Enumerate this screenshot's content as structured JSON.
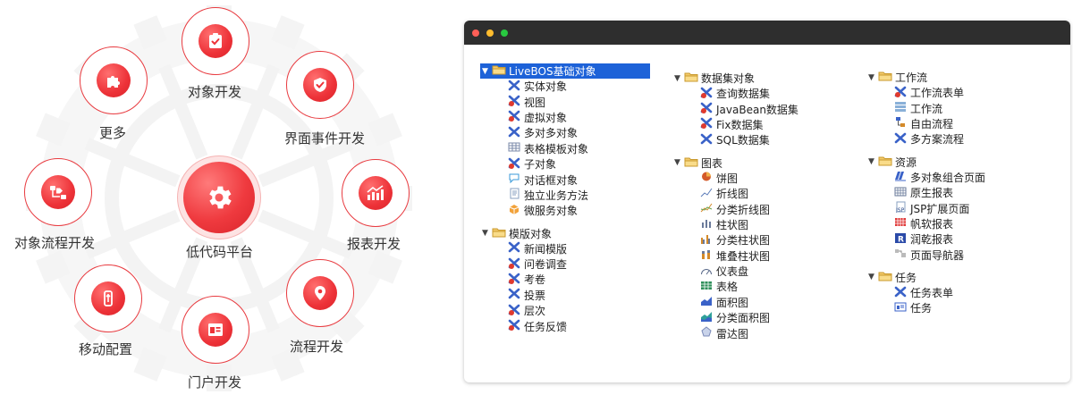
{
  "wheel": {
    "center_label": "低代码平台",
    "nodes": [
      {
        "label": "对象开发",
        "icon": "clipboard-check-icon"
      },
      {
        "label": "界面事件开发",
        "icon": "shield-check-icon"
      },
      {
        "label": "报表开发",
        "icon": "bar-chart-icon"
      },
      {
        "label": "流程开发",
        "icon": "map-pin-icon"
      },
      {
        "label": "门户开发",
        "icon": "portal-window-icon"
      },
      {
        "label": "移动配置",
        "icon": "usb-icon"
      },
      {
        "label": "对象流程开发",
        "icon": "flow-diagram-icon"
      },
      {
        "label": "更多",
        "icon": "puzzle-icon"
      }
    ]
  },
  "window": {
    "col1": [
      {
        "title": "LiveBOS基础对象",
        "selected": true,
        "items": [
          {
            "label": "实体对象",
            "icon": "x-node-icon"
          },
          {
            "label": "视图",
            "icon": "x-node-red-icon"
          },
          {
            "label": "虚拟对象",
            "icon": "x-node-red-icon"
          },
          {
            "label": "多对多对象",
            "icon": "x-node-icon"
          },
          {
            "label": "表格模板对象",
            "icon": "grid-icon"
          },
          {
            "label": "子对象",
            "icon": "x-node-red-icon"
          },
          {
            "label": "对话框对象",
            "icon": "speech-bubble-icon"
          },
          {
            "label": "独立业务方法",
            "icon": "document-icon"
          },
          {
            "label": "微服务对象",
            "icon": "cube-icon"
          }
        ]
      },
      {
        "title": "模版对象",
        "selected": false,
        "items": [
          {
            "label": "新闻模版",
            "icon": "x-node-icon"
          },
          {
            "label": "问卷调查",
            "icon": "x-node-red-icon"
          },
          {
            "label": "考卷",
            "icon": "x-node-red-icon"
          },
          {
            "label": "投票",
            "icon": "x-node-icon"
          },
          {
            "label": "层次",
            "icon": "x-node-red-icon"
          },
          {
            "label": "任务反馈",
            "icon": "x-node-red-icon"
          }
        ]
      }
    ],
    "col2": [
      {
        "title": "数据集对象",
        "selected": false,
        "items": [
          {
            "label": "查询数据集",
            "icon": "x-node-red-icon"
          },
          {
            "label": "JavaBean数据集",
            "icon": "x-node-red-icon"
          },
          {
            "label": "Fix数据集",
            "icon": "x-node-red-icon"
          },
          {
            "label": "SQL数据集",
            "icon": "x-node-icon"
          }
        ]
      },
      {
        "title": "图表",
        "selected": false,
        "items": [
          {
            "label": "饼图",
            "icon": "pie-chart-icon"
          },
          {
            "label": "折线图",
            "icon": "line-chart-icon"
          },
          {
            "label": "分类折线图",
            "icon": "multi-line-chart-icon"
          },
          {
            "label": "柱状图",
            "icon": "bar-chart-icon"
          },
          {
            "label": "分类柱状图",
            "icon": "grouped-bar-chart-icon"
          },
          {
            "label": "堆叠柱状图",
            "icon": "stacked-bar-chart-icon"
          },
          {
            "label": "仪表盘",
            "icon": "gauge-icon"
          },
          {
            "label": "表格",
            "icon": "table-icon"
          },
          {
            "label": "面积图",
            "icon": "area-chart-icon"
          },
          {
            "label": "分类面积图",
            "icon": "grouped-area-chart-icon"
          },
          {
            "label": "雷达图",
            "icon": "radar-chart-icon"
          }
        ]
      }
    ],
    "col3": [
      {
        "title": "工作流",
        "selected": false,
        "items": [
          {
            "label": "工作流表单",
            "icon": "x-node-red-icon"
          },
          {
            "label": "工作流",
            "icon": "workflow-icon"
          },
          {
            "label": "自由流程",
            "icon": "free-flow-icon"
          },
          {
            "label": "多方案流程",
            "icon": "x-node-icon"
          }
        ]
      },
      {
        "title": "资源",
        "selected": false,
        "items": [
          {
            "label": "多对象组合页面",
            "icon": "composite-page-icon"
          },
          {
            "label": "原生报表",
            "icon": "native-report-icon"
          },
          {
            "label": "JSP扩展页面",
            "icon": "jsp-page-icon"
          },
          {
            "label": "帆软报表",
            "icon": "finereport-icon"
          },
          {
            "label": "润乾报表",
            "icon": "runqian-report-icon"
          },
          {
            "label": "页面导航器",
            "icon": "page-navigator-icon"
          }
        ]
      },
      {
        "title": "任务",
        "selected": false,
        "items": [
          {
            "label": "任务表单",
            "icon": "x-node-icon"
          },
          {
            "label": "任务",
            "icon": "task-icon"
          }
        ]
      }
    ]
  }
}
